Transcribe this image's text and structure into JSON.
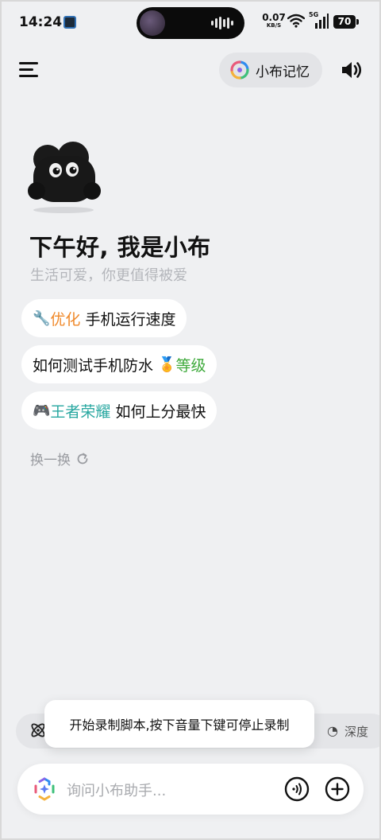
{
  "status_bar": {
    "time": "14:24",
    "net_speed_value": "0.07",
    "net_speed_unit": "KB/S",
    "network_type": "5G",
    "battery": "70"
  },
  "header": {
    "memory_label": "小布记忆"
  },
  "greeting": {
    "title": "下午好, 我是小布",
    "subtitle": "生活可爱，你更值得被爱"
  },
  "suggestions": [
    {
      "emoji": "🔧",
      "highlight": "优化",
      "text": " 手机运行速度"
    },
    {
      "text": "如何测试手机防水 ",
      "emoji": "🏅",
      "highlight": "等级"
    },
    {
      "emoji": "🎮",
      "highlight": "王者荣耀",
      "text": " 如何上分最快"
    }
  ],
  "refresh_label": "换一换",
  "quick_bar": {
    "right_label": "深度"
  },
  "toast": "开始录制脚本,按下音量下键可停止录制",
  "input": {
    "placeholder": "询问小布助手..."
  },
  "colors": {
    "background": "#eff0f2",
    "highlight_orange": "#f0892a",
    "highlight_green": "#3faa3c",
    "highlight_teal": "#27a7a0"
  },
  "icons": [
    "menu-icon",
    "memory-icon",
    "speaker-icon",
    "refresh-icon",
    "atom-icon",
    "assistant-logo-icon",
    "voice-icon",
    "plus-icon",
    "wifi-icon",
    "signal-icon",
    "battery-icon"
  ]
}
